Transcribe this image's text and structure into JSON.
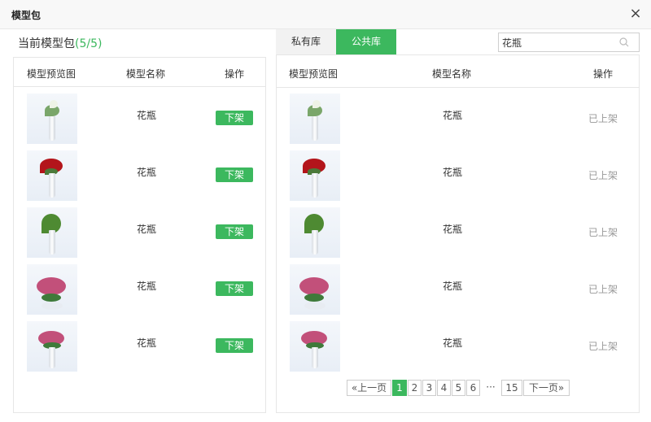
{
  "dialog": {
    "title": "模型包",
    "close_label": "×"
  },
  "package": {
    "label": "当前模型包",
    "count": "(5/5)"
  },
  "left_table": {
    "headers": [
      "模型预览图",
      "模型名称",
      "操作"
    ],
    "rows": [
      {
        "name": "花瓶",
        "action": "下架"
      },
      {
        "name": "花瓶",
        "action": "下架"
      },
      {
        "name": "花瓶",
        "action": "下架"
      },
      {
        "name": "花瓶",
        "action": "下架"
      },
      {
        "name": "花瓶",
        "action": "下架"
      }
    ]
  },
  "tabs": {
    "private": "私有库",
    "public": "公共库"
  },
  "search": {
    "value": "花瓶",
    "icon": "search-icon"
  },
  "right_table": {
    "headers": [
      "模型预览图",
      "模型名称",
      "操作"
    ],
    "rows": [
      {
        "name": "花瓶",
        "status": "已上架"
      },
      {
        "name": "花瓶",
        "status": "已上架"
      },
      {
        "name": "花瓶",
        "status": "已上架"
      },
      {
        "name": "花瓶",
        "status": "已上架"
      },
      {
        "name": "花瓶",
        "status": "已上架"
      }
    ]
  },
  "pagination": {
    "prev": "«上一页",
    "pages": [
      "1",
      "2",
      "3",
      "4",
      "5",
      "6"
    ],
    "ellipsis": "···",
    "last": "15",
    "next": "下一页»",
    "current": "1"
  },
  "colors": {
    "accent": "#3cb85e",
    "muted": "#999999"
  }
}
